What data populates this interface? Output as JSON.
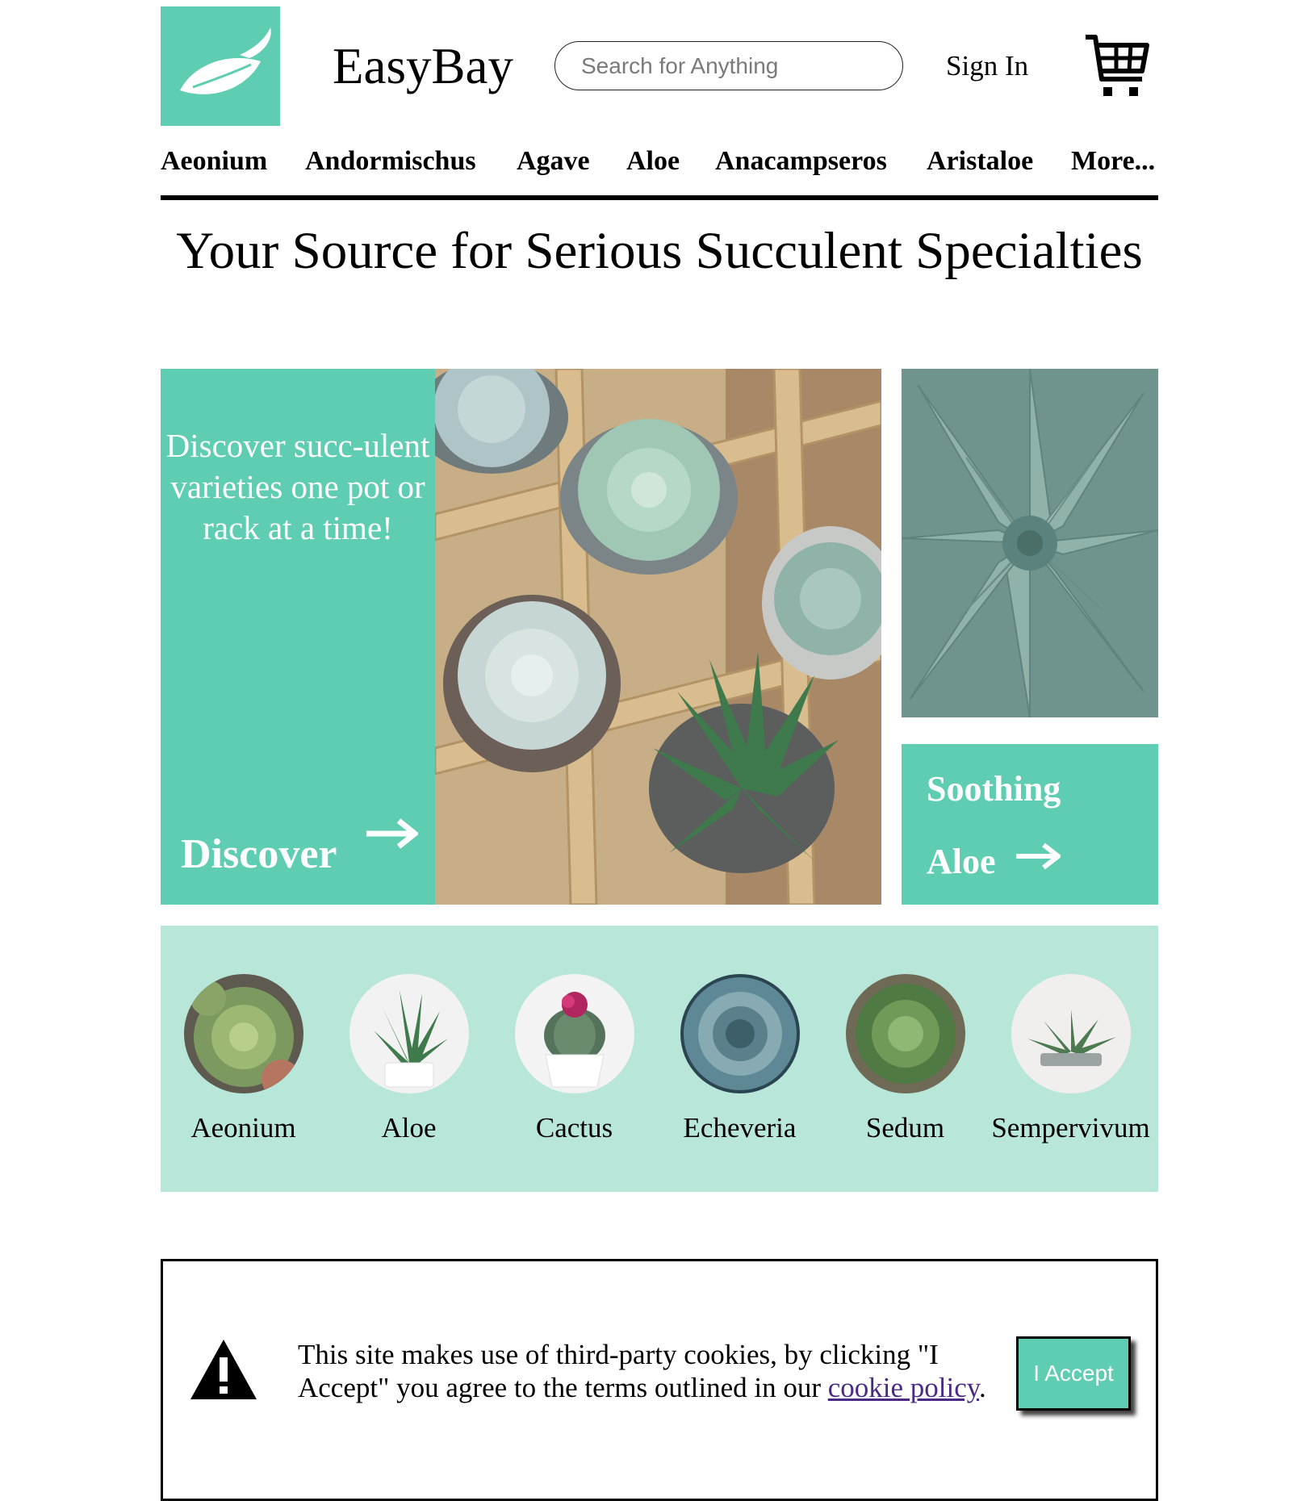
{
  "header": {
    "brand": "EasyBay",
    "search_placeholder": "Search for Anything",
    "sign_in": "Sign In"
  },
  "nav": {
    "items": [
      "Aeonium",
      "Andormischus",
      "Agave",
      "Aloe",
      "Anacampseros",
      "Aristaloe",
      "More..."
    ]
  },
  "headline": "Your Source for Serious Succulent Specialties",
  "hero": {
    "blurb": "Discover succ-ulent varieties one pot or rack at a time!",
    "discover_link": "Discover",
    "aloe_line1": "Soothing",
    "aloe_line2": "Aloe"
  },
  "categories": [
    "Aeonium",
    "Aloe",
    "Cactus",
    "Echeveria",
    "Sedum",
    "Sempervivum"
  ],
  "cookie": {
    "text": "This site makes use of third-party cookies, by clicking \"I Accept\" you agree to the terms outlined in our ",
    "link": "cookie policy",
    "period": ".",
    "accept": "I Accept"
  },
  "colors": {
    "accent": "#5ecdb2",
    "accent_light": "#b8e6d9",
    "link": "#4b2a86"
  },
  "icons": [
    "leaf-logo-icon",
    "cart-icon",
    "arrow-right-icon",
    "warning-icon"
  ]
}
